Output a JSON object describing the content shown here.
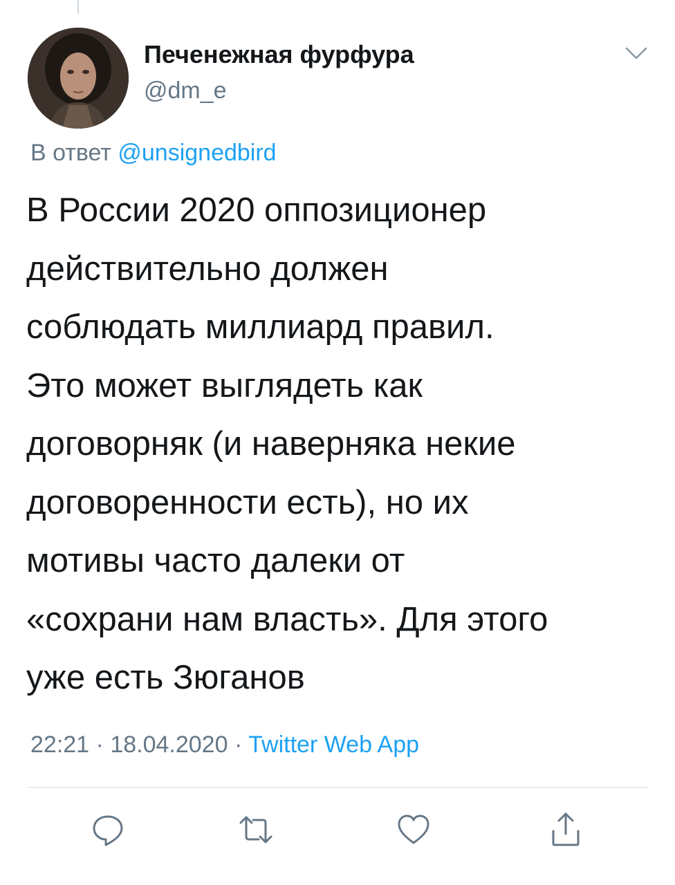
{
  "tweet": {
    "author": {
      "display_name": "Печенежная фурфура",
      "handle": "@dm_e",
      "avatar_icon": "user-avatar"
    },
    "reply_prefix": "В ответ",
    "reply_to": "@unsignedbird",
    "text": "В России 2020 оппозиционер\nдействительно должен\nсоблюдать миллиард правил.\nЭто может выглядеть как\nдоговорняк (и наверняка некие\nдоговоренности есть), но их\nмотивы часто далеки от\n«сохрани нам власть». Для этого\nуже есть Зюганов",
    "time": "22:21",
    "separator": "·",
    "date": "18.04.2020",
    "source": "Twitter Web App"
  },
  "actions": [
    {
      "icon": "reply-icon"
    },
    {
      "icon": "retweet-icon"
    },
    {
      "icon": "like-icon"
    },
    {
      "icon": "share-icon"
    }
  ],
  "colors": {
    "accent": "#1da1f2",
    "secondary_text": "#657786",
    "primary_text": "#14171a",
    "divider": "#e6ecf0"
  }
}
